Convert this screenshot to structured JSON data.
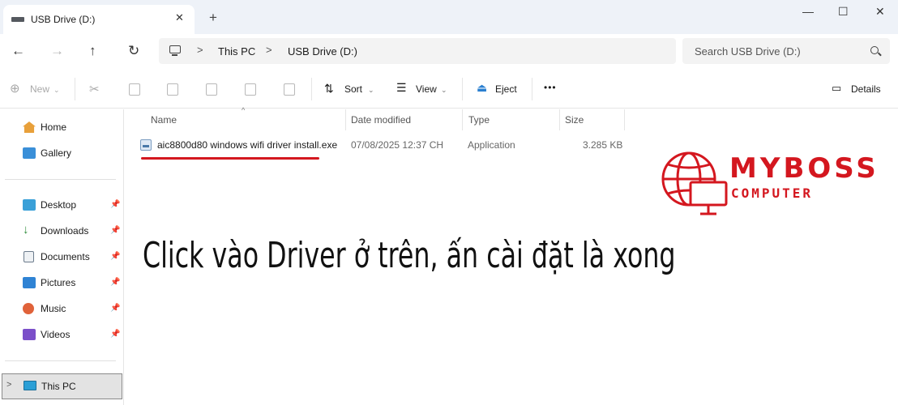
{
  "window": {
    "tab_title": "USB Drive (D:)",
    "tab_close": "✕",
    "new_tab": "+",
    "minimize": "—",
    "maximize": "☐",
    "close": "✕"
  },
  "nav": {
    "back": "←",
    "forward": "→",
    "up": "↑",
    "refresh": "↻",
    "breadcrumb": [
      "This PC",
      "USB Drive (D:)"
    ],
    "separator": ">",
    "search_placeholder": "Search USB Drive (D:)"
  },
  "toolbar": {
    "new_label": "New",
    "sort_label": "Sort",
    "view_label": "View",
    "eject_label": "Eject",
    "more_label": "•••",
    "details_label": "Details"
  },
  "sidebar": {
    "top_items": [
      {
        "label": "Home",
        "icon": "home-icon"
      },
      {
        "label": "Gallery",
        "icon": "gallery-icon"
      }
    ],
    "pinned_items": [
      {
        "label": "Desktop",
        "icon": "desktop-icon",
        "color": "#3aa0d8"
      },
      {
        "label": "Downloads",
        "icon": "download-icon",
        "color": "#2e8b3a"
      },
      {
        "label": "Documents",
        "icon": "documents-icon",
        "color": "#6b7b8c"
      },
      {
        "label": "Pictures",
        "icon": "pictures-icon",
        "color": "#2f83d4"
      },
      {
        "label": "Music",
        "icon": "music-icon",
        "color": "#e0623a"
      },
      {
        "label": "Videos",
        "icon": "videos-icon",
        "color": "#7b4fc9"
      }
    ],
    "this_pc": "This PC",
    "pin_glyph": "📌"
  },
  "columns": [
    "Name",
    "Date modified",
    "Type",
    "Size"
  ],
  "files": [
    {
      "name": "aic8800d80 windows wifi driver install.exe",
      "date_modified": "07/08/2025 12:37 CH",
      "type": "Application",
      "size": "3.285 KB"
    }
  ],
  "annotation": "Click vào Driver ở trên, ấn cài đặt là xong",
  "logo": {
    "line1": "MYBOSS",
    "line2": "COMPUTER",
    "color": "#d4171f"
  },
  "colors": {
    "accent_red": "#d4171f",
    "titlebar_bg": "#eef2f8"
  }
}
